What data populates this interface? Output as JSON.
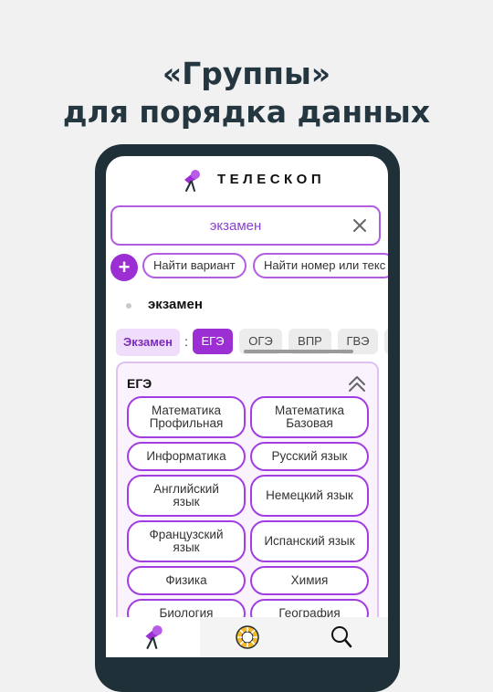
{
  "headline": {
    "line1": "«Группы»",
    "line2": "для порядка данных"
  },
  "app": {
    "title": "ТЕЛЕСКОП",
    "logo_icon": "telescope-icon"
  },
  "search": {
    "value": "экзамен",
    "clear_icon": "close-icon"
  },
  "quick_actions": {
    "plus_label": "+",
    "chips": [
      "Найти вариант",
      "Найти номер или текс"
    ]
  },
  "breadcrumb": {
    "text": "экзамен"
  },
  "filter": {
    "label": "Экзамен",
    "separator": ":",
    "tabs": [
      "ЕГЭ",
      "ОГЭ",
      "ВПР",
      "ГВЭ"
    ],
    "active_tab": "ЕГЭ"
  },
  "group": {
    "title": "ЕГЭ",
    "collapse_icon": "chevron-up-double-icon",
    "subjects": [
      "Математика\nПрофильная",
      "Математика\nБазовая",
      "Информатика",
      "Русский язык",
      "Английский\nязык",
      "Немецкий язык",
      "Французский\nязык",
      "Испанский язык",
      "Физика",
      "Химия",
      "Биология",
      "География"
    ]
  },
  "bottom_nav": {
    "items": [
      "telescope-icon",
      "sun-icon",
      "search-icon"
    ],
    "active_index": 0
  },
  "colors": {
    "accent": "#9b2fd4",
    "phone_frame": "#1f3038",
    "headline": "#24363f"
  }
}
